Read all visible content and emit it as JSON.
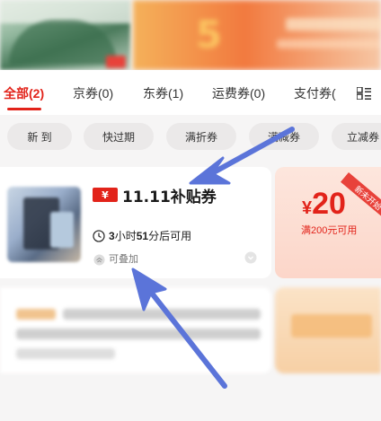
{
  "tabs": [
    {
      "label": "全部(2)",
      "active": true
    },
    {
      "label": "京券(0)"
    },
    {
      "label": "东券(1)"
    },
    {
      "label": "运费券(0)"
    },
    {
      "label": "支付券("
    }
  ],
  "filters": [
    "新 到",
    "快过期",
    "满折券",
    "满减券",
    "立减券"
  ],
  "coupon": {
    "tag": "¥",
    "title": "11.11补贴券",
    "time_prefix": "3",
    "time_unit1": "小时",
    "time_mid": "51",
    "time_suffix": "分后可用",
    "stackable": "可叠加",
    "corner_badge": "新未开始",
    "currency": "¥",
    "amount": "20",
    "condition": "满200元可用"
  },
  "colors": {
    "accent": "#e2231a",
    "arrow": "#5b74d9"
  },
  "icons": [
    "grid-icon",
    "clock-icon",
    "stack-icon",
    "more-icon"
  ]
}
